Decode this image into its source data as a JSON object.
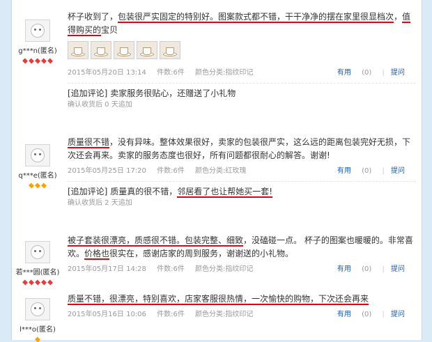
{
  "reviews": [
    {
      "user": "g***n(匿名)",
      "rank_color": "red",
      "text_parts": [
        {
          "t": "杯子收到了，",
          "u": false
        },
        {
          "t": "包装很严实固定的特别好。图案款式都不错，干干净净的摆在家里很显档次",
          "u": true
        },
        {
          "t": "，",
          "u": false
        },
        {
          "t": "值得购买的",
          "u": true
        },
        {
          "t": "宝贝",
          "u": false
        }
      ],
      "has_photos": true,
      "photo_count": 5,
      "date": "2015年05月20日 13:14",
      "count": "件数:6件",
      "color": "颜色分类:指纹印记",
      "useful_label": "有用",
      "useful_count": "(0)",
      "ask_label": "提问",
      "append_tag": "[追加评论]",
      "append_text": " 卖家服务很贴心，还赠送了小礼物",
      "append_meta": "确认收货后 0 天追加"
    },
    {
      "user": "q***e(匿名)",
      "rank_color": "gold",
      "text_parts": [
        {
          "t": "质量很不错",
          "u": true
        },
        {
          "t": "，没有异味。整体效果很好，卖家的包装很严实，这么远的距离包装完好无损，下次还会再来。卖家的服务态度也很好，所有问题都很耐心的解答。谢谢!",
          "u": false
        }
      ],
      "has_photos": false,
      "date": "2015年05月25日 17:20",
      "count": "件数:6件",
      "color": "颜色分类:红玫瑰",
      "useful_label": "有用",
      "useful_count": "(0)",
      "ask_label": "提问",
      "append_tag": "[追加评论]",
      "append_text_parts": [
        {
          "t": " 质量真的很不错，",
          "u": false
        },
        {
          "t": "邻居看了也让帮她买一套!",
          "u": true
        }
      ],
      "append_meta": "确认收货后 2 天追加"
    },
    {
      "user": "若***圆(匿名)",
      "rank_color": "red",
      "text_parts": [
        {
          "t": "被子套装很漂亮，质感很不错。包装完整、细致",
          "u": true
        },
        {
          "t": "，没磕碰一点。 杯子的图案也暖暖的。非常喜欢。",
          "u": false
        },
        {
          "t": "价格也",
          "u": true
        },
        {
          "t": "很实在，感谢店家的周到服务，谢谢送的小礼物。",
          "u": false
        }
      ],
      "has_photos": false,
      "date": "2015年05月17日 14:28",
      "count": "件数:6件",
      "color": "颜色分类:指纹印记",
      "useful_label": "有用",
      "useful_count": "(0)",
      "ask_label": "提问"
    },
    {
      "user": "l***o(匿名)",
      "rank_color": "gold",
      "text_parts": [
        {
          "t": "质量不错，很漂亮，特别喜欢，店家客服很热情，一次愉快的购物，下次还会再来",
          "u": true
        }
      ],
      "has_photos": false,
      "date": "2015年05月16日 10:06",
      "count": "件数:6件",
      "color": "颜色分类:指纹印记",
      "useful_label": "有用",
      "useful_count": "(0)",
      "ask_label": "提问"
    }
  ]
}
